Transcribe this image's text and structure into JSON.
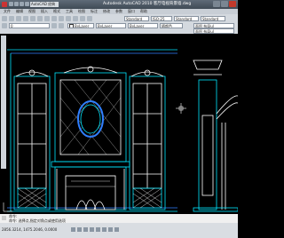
{
  "app": {
    "title": "Autodesk AutoCAD 2010   客厅电视背景墙.dwg",
    "workspace": "AutoCAD 经典"
  },
  "menu": {
    "tabs": [
      "文件",
      "编辑",
      "视图",
      "插入",
      "格式",
      "工具",
      "绘图",
      "标注",
      "修改",
      "参数",
      "窗口",
      "帮助"
    ]
  },
  "toolbar": {
    "text_style": "Standard",
    "dim_style": "ISO-25",
    "table_style": "Standard",
    "mleader_style": "Standard",
    "layer": "0",
    "color": "ByLayer",
    "linetype": "ByLayer",
    "lineweight": "ByLayer",
    "plot_style": "随颜色",
    "view_combo": "面积 布局ul",
    "view_combo2": "面积 布局ul"
  },
  "command": {
    "line1": "命令:",
    "line2": "命令:  选择点,指定对角点或使用选项"
  },
  "status": {
    "coords": "2856.3214, 1475.2046, 0.0000"
  },
  "colors": {
    "cad_cyan": "#00e5ff",
    "cad_white": "#ffffff",
    "cad_blue": "#2f7fff",
    "background": "#000000"
  }
}
